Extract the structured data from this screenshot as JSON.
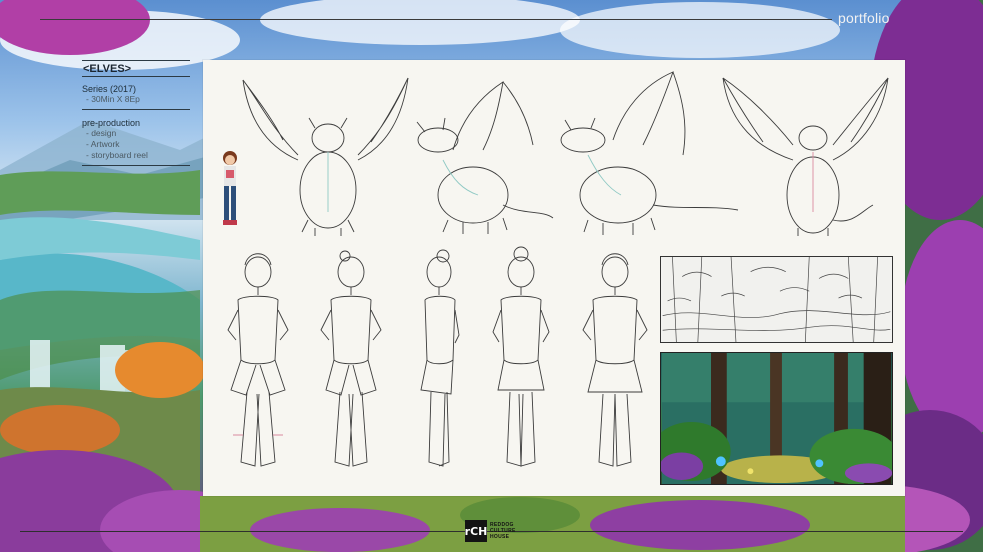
{
  "header": {
    "title": "portfolio"
  },
  "project": {
    "title": "<ELVES>",
    "series": "Series (2017)",
    "series_detail": "- 30Min X 8Ep",
    "production_heading": "pre-production",
    "production_items": [
      "- design",
      "- Artwork",
      "- storyboard reel"
    ]
  },
  "footer": {
    "logo_mark": "rCH",
    "logo_lines": [
      "REDDOG",
      "CULTURE",
      "HOUSE"
    ]
  },
  "colors": {
    "paper": "#f7f6f1",
    "sketch_line": "#3c3c3c",
    "sketch_accent": "#8fc9c4",
    "accent_pink": "#d98aa0"
  }
}
